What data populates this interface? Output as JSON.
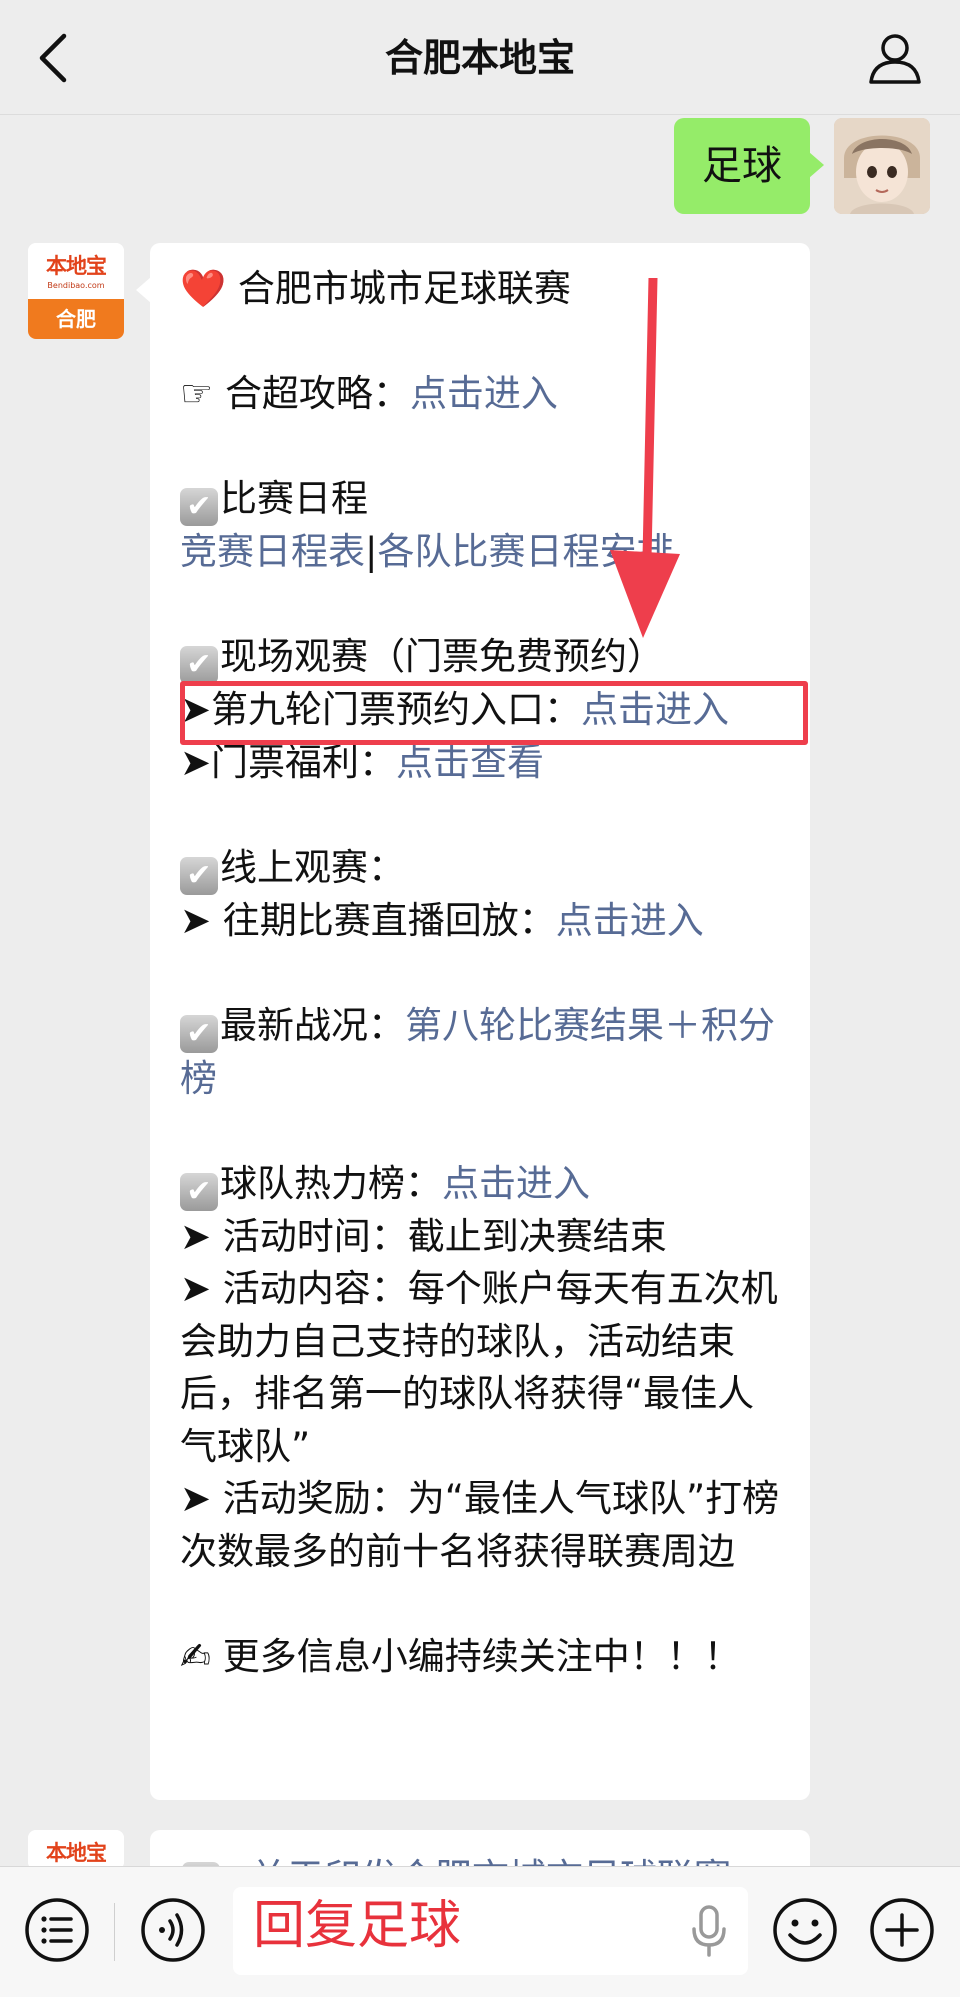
{
  "header": {
    "title": "合肥本地宝",
    "back_icon": "chevron-left-icon",
    "profile_icon": "user-icon"
  },
  "outgoing": {
    "text": "足球"
  },
  "official_avatar": {
    "brand": "本地宝",
    "site": "Bendibao.com",
    "city": "合肥"
  },
  "message": {
    "heart_icon": "❤️",
    "title": "合肥市城市足球联赛",
    "strategy_pointer": "☞",
    "strategy_label": "合超攻略：",
    "strategy_link": "点击进入",
    "schedule_check": "✔",
    "schedule_title": "比赛日程",
    "schedule_link1": "竞赛日程表",
    "schedule_sep": "|",
    "schedule_link2": "各队比赛日程安排",
    "watch_check": "✔",
    "watch_title": "现场观赛（门票免费预约）",
    "watch_arrow1": "➤",
    "watch_item1_label": "第九轮门票预约入口：",
    "watch_item1_link": "点击进入",
    "watch_arrow2": "➤",
    "watch_item2_label": "门票福利：",
    "watch_item2_link": "点击查看",
    "online_check": "✔",
    "online_title": "线上观赛：",
    "online_arrow": "➤",
    "online_item_label": " 往期比赛直播回放：",
    "online_item_link": "点击进入",
    "latest_check": "✔",
    "latest_label": "最新战况：",
    "latest_link": "第八轮比赛结果＋积分榜",
    "ranking_check": "✔",
    "ranking_label": "球队热力榜：",
    "ranking_link": "点击进入",
    "act_arrow1": "➤",
    "activity_time": " 活动时间：截止到决赛结束",
    "act_arrow2": "➤",
    "activity_content": " 活动内容：每个账户每天有五次机会助力自己支持的球队，活动结束后，排名第一的球队将获得“最佳人气球队”",
    "act_arrow3": "➤",
    "activity_reward": " 活动奖励：为“最佳人气球队”打榜次数最多的前十名将获得联赛周边",
    "closing_icon": "✍",
    "closing": " 更多信息小编持续关注中！！！"
  },
  "next_message_peek": {
    "text": "关于印发合肥市城市足球联赛"
  },
  "bottom_bar": {
    "input_value": "回复足球",
    "menu_icon": "menu-list-icon",
    "voice_icon": "voice-icon",
    "mic_icon": "microphone-icon",
    "emoji_icon": "emoji-icon",
    "plus_icon": "plus-icon"
  },
  "colors": {
    "background": "#ededed",
    "outgoing_bubble": "#95ec69",
    "link": "#576b95",
    "annotation": "#ee3e4c",
    "input_text": "#e8323c"
  }
}
